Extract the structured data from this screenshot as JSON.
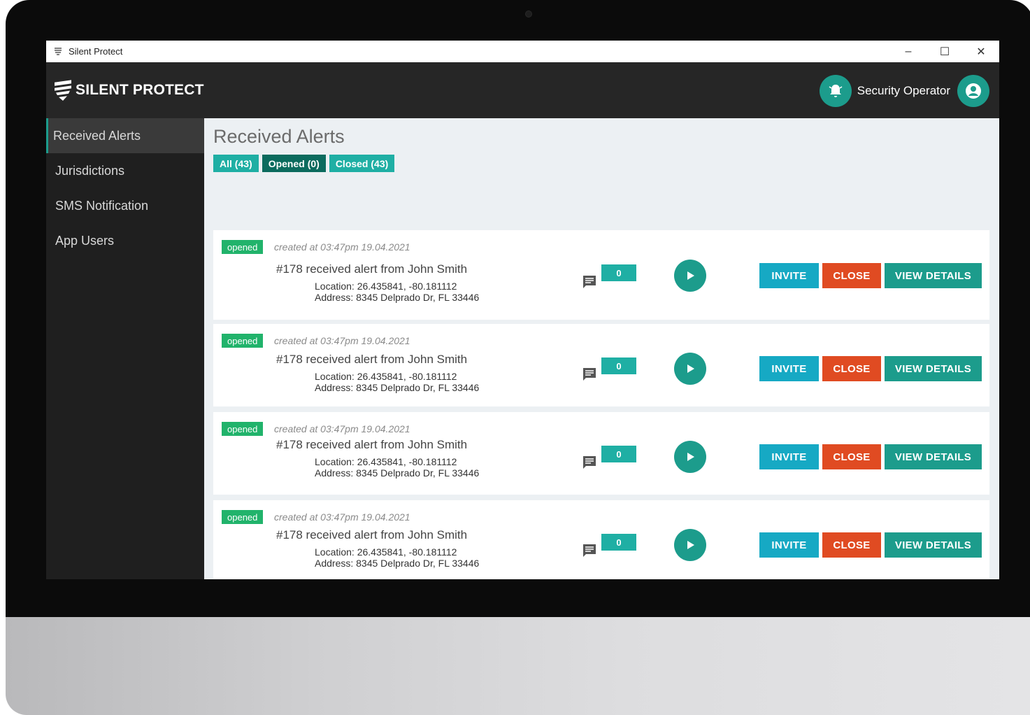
{
  "window": {
    "title": "Silent Protect"
  },
  "header": {
    "logo_text": "SILENT PROTECT",
    "user_name": "Security Operator"
  },
  "sidebar": {
    "items": [
      {
        "label": "Received Alerts",
        "active": true
      },
      {
        "label": "Jurisdictions",
        "active": false
      },
      {
        "label": "SMS Notification",
        "active": false
      },
      {
        "label": "App Users",
        "active": false
      }
    ]
  },
  "main": {
    "title": "Received Alerts",
    "filters": [
      {
        "label": "All (43)",
        "selected": false
      },
      {
        "label": "Opened (0)",
        "selected": true
      },
      {
        "label": "Closed (43)",
        "selected": false
      }
    ],
    "alerts": [
      {
        "status": "opened",
        "created": "created at 03:47pm 19.04.2021",
        "title": "#178 received alert from John Smith",
        "location": "Location: 26.435841, -80.181112",
        "address": "Address: 8345 Delprado Dr, FL 33446",
        "messages": "0"
      },
      {
        "status": "opened",
        "created": "created at 03:47pm 19.04.2021",
        "title": "#178 received alert from John Smith",
        "location": "Location: 26.435841, -80.181112",
        "address": "Address: 8345 Delprado Dr, FL 33446",
        "messages": "0"
      },
      {
        "status": "opened",
        "created": "created at 03:47pm 19.04.2021",
        "title": "#178 received alert from John Smith",
        "location": "Location: 26.435841, -80.181112",
        "address": "Address: 8345 Delprado Dr, FL 33446",
        "messages": "0"
      },
      {
        "status": "opened",
        "created": "created at 03:47pm 19.04.2021",
        "title": "#178 received alert from John Smith",
        "location": "Location: 26.435841, -80.181112",
        "address": "Address: 8345 Delprado Dr, FL 33446",
        "messages": "0"
      }
    ],
    "actions": {
      "invite": "INVITE",
      "close": "CLOSE",
      "details": "VIEW DETAILS"
    }
  },
  "colors": {
    "accent": "#1c9c8c",
    "invite": "#16a9c4",
    "close": "#e04b22",
    "badge": "#21b36b",
    "topbar": "#262626",
    "sidebar": "#1f1f1f"
  }
}
